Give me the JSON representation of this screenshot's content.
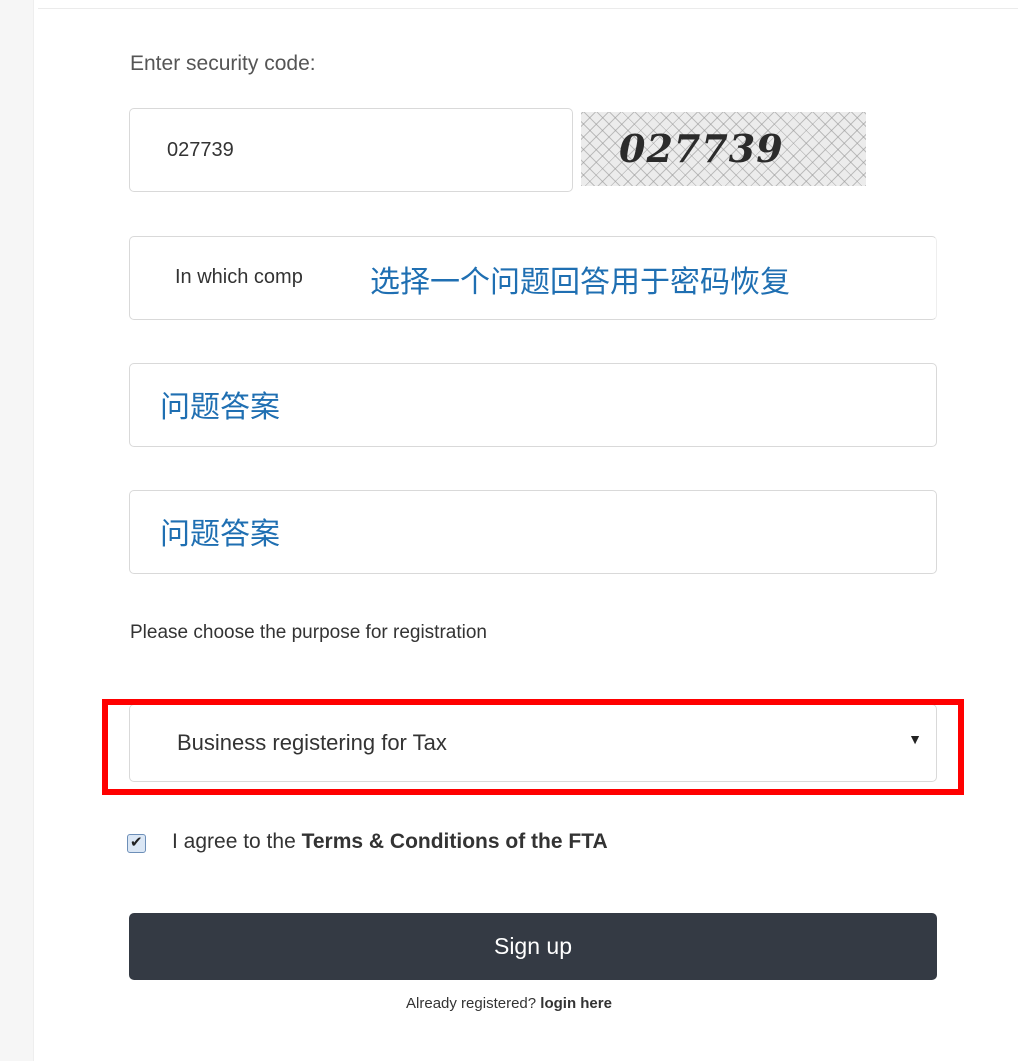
{
  "form": {
    "security_label": "Enter security code:",
    "security_code_value": "027739",
    "captcha_text": "027739",
    "question_select_value": "In which comp",
    "question_overlay_text": "选择一个问题回答用于密码恢复",
    "answer1_placeholder": "问题答案",
    "answer2_placeholder": "问题答案",
    "purpose_label": "Please choose the purpose for registration",
    "purpose_selected": "Business registering for Tax",
    "agree_prefix": "I agree to the ",
    "agree_link": "Terms & Conditions of the FTA",
    "agree_checked": true,
    "signup_label": "Sign up",
    "already_text": "Already registered?",
    "login_link": "login here"
  },
  "colors": {
    "highlight": "#ff0000",
    "button_bg": "#343a44",
    "annotation": "#1f6fb2"
  },
  "icons": {
    "dropdown": "caret-down-icon",
    "checkbox": "checkmark-icon"
  }
}
